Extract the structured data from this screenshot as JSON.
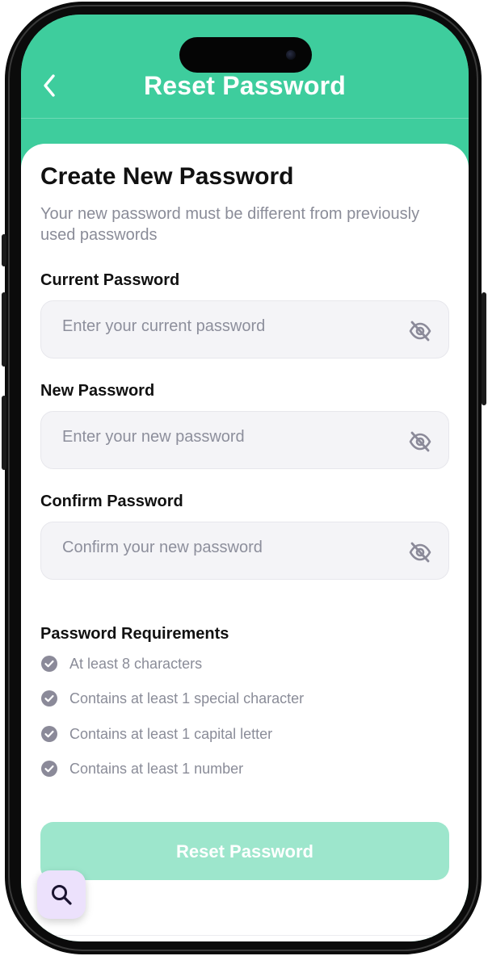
{
  "header": {
    "title": "Reset Password",
    "back_icon": "chevron-left-icon"
  },
  "form": {
    "title": "Create New Password",
    "subtitle": "Your new password must be different from previously used passwords",
    "fields": [
      {
        "label": "Current Password",
        "placeholder": "Enter your current password",
        "value": "",
        "icon": "eye-off-icon"
      },
      {
        "label": "New Password",
        "placeholder": "Enter your new password",
        "value": "",
        "icon": "eye-off-icon"
      },
      {
        "label": "Confirm Password",
        "placeholder": "Confirm your new password",
        "value": "",
        "icon": "eye-off-icon"
      }
    ]
  },
  "requirements": {
    "title": "Password Requirements",
    "items": [
      {
        "text": "At least 8 characters",
        "icon": "check-circle-icon"
      },
      {
        "text": "Contains at least 1 special character",
        "icon": "check-circle-icon"
      },
      {
        "text": "Contains at least 1 capital letter",
        "icon": "check-circle-icon"
      },
      {
        "text": "Contains at least 1 number",
        "icon": "check-circle-icon"
      }
    ]
  },
  "submit": {
    "label": "Reset Password",
    "enabled": false
  },
  "fab": {
    "icon": "search-icon"
  },
  "colors": {
    "accent": "#3ecd9d",
    "accent_disabled": "#9de6cc",
    "muted_text": "#8a8c98",
    "field_bg": "#f4f4f7",
    "check_icon": "#8b8a99",
    "fab_bg": "#ece1fc"
  }
}
